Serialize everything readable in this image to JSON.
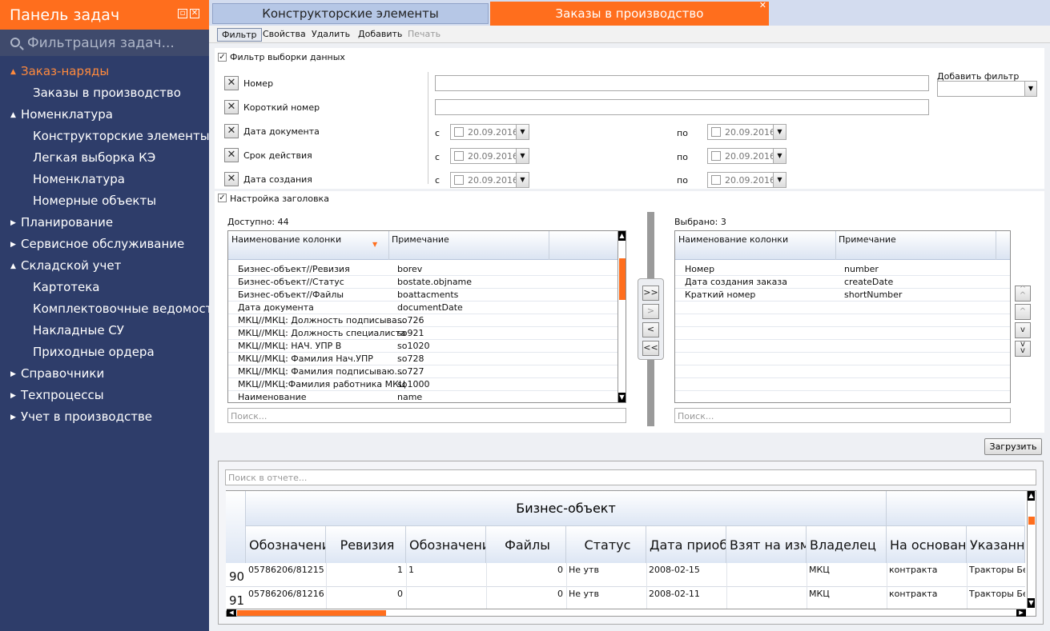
{
  "sidebar": {
    "title": "Панель задач",
    "filter_placeholder": "Фильтрация задач...",
    "items": [
      {
        "label": "Заказ-наряды",
        "level": 1,
        "expanded": true,
        "active": true
      },
      {
        "label": "Заказы в производство",
        "level": 2
      },
      {
        "label": "Номенклатура",
        "level": 1,
        "expanded": true
      },
      {
        "label": "Конструкторские элементы",
        "level": 2
      },
      {
        "label": "Легкая  выборка КЭ",
        "level": 2
      },
      {
        "label": "Номенклатура",
        "level": 2
      },
      {
        "label": "Номерные объекты",
        "level": 2
      },
      {
        "label": "Планирование",
        "level": 1,
        "expanded": false
      },
      {
        "label": "Сервисное обслуживание",
        "level": 1,
        "expanded": false
      },
      {
        "label": "Складской учет",
        "level": 1,
        "expanded": true
      },
      {
        "label": "Картотека",
        "level": 2
      },
      {
        "label": "Комплектовочные ведомости",
        "level": 2
      },
      {
        "label": "Накладные СУ",
        "level": 2
      },
      {
        "label": "Приходные ордера",
        "level": 2
      },
      {
        "label": "Справочники",
        "level": 1,
        "expanded": false
      },
      {
        "label": "Техпроцессы",
        "level": 1,
        "expanded": false
      },
      {
        "label": "Учет в производстве",
        "level": 1,
        "expanded": false
      }
    ]
  },
  "tabs": [
    {
      "label": "Конструкторские элементы",
      "active": false
    },
    {
      "label": "Заказы в производство",
      "active": true
    }
  ],
  "toolbar": {
    "filter": "Фильтр",
    "properties": "Свойства",
    "delete": "Удалить",
    "add": "Добавить",
    "print": "Печать"
  },
  "filter_section": {
    "title": "Фильтр выборки данных",
    "add_filter_label": "Добавить фильтр",
    "from": "с",
    "to": "по",
    "date_value": "20.09.2016",
    "fields": [
      "Номер",
      "Короткий номер",
      "Дата документа",
      "Срок действия",
      "Дата создания"
    ]
  },
  "header_section": {
    "title": "Настройка заголовка",
    "available_label": "Доступно: 44",
    "selected_label": "Выбрано: 3",
    "col_name": "Наименование колонки",
    "col_note": "Примечание",
    "search_placeholder": "Поиск...",
    "available": [
      [
        "Бизнес-объект//Ревизия",
        "borev"
      ],
      [
        "Бизнес-объект//Статус",
        "bostate.objname"
      ],
      [
        "Бизнес-объект//Файлы",
        "boattacments"
      ],
      [
        "Дата документа",
        "documentDate"
      ],
      [
        "МКЦ//МКЦ: Должность подписыва...",
        "so726"
      ],
      [
        "МКЦ//МКЦ: Должность специалиста",
        "so921"
      ],
      [
        "МКЦ//МКЦ: НАЧ. УПР В",
        "so1020"
      ],
      [
        "МКЦ//МКЦ: Фамилия Нач.УПР",
        "so728"
      ],
      [
        "МКЦ//МКЦ: Фамилия подписываю...",
        "so727"
      ],
      [
        "МКЦ//МКЦ:Фамилия работника МКЦ",
        "so1000"
      ],
      [
        "Наименование",
        "name"
      ]
    ],
    "selected": [
      [
        "Номер",
        "number"
      ],
      [
        "Дата создания заказа",
        "createDate"
      ],
      [
        "Краткий номер",
        "shortNumber"
      ]
    ],
    "move_buttons": [
      ">>",
      ">",
      "<",
      "<<"
    ]
  },
  "load_button": "Загрузить",
  "report": {
    "search_placeholder": "Поиск в отчете...",
    "group_header": "Бизнес-объект",
    "sort_index": "1",
    "columns": [
      "Обозначени",
      "Ревизия",
      "Обозначени",
      "Файлы",
      "Статус",
      "Дата приобр",
      "Взят на изм",
      "Владелец",
      "На основани",
      "Указанны"
    ],
    "rows": [
      {
        "num": "90",
        "cells": [
          "05786206/81215",
          "1",
          "1",
          "0",
          "Не утв",
          "2008-02-15",
          "",
          "МКЦ",
          "контракта",
          "Тракторы Бе"
        ]
      },
      {
        "num": "91",
        "cells": [
          "05786206/81216",
          "0",
          "",
          "0",
          "Не утв",
          "2008-02-11",
          "",
          "МКЦ",
          "контракта",
          "Тракторы Бе"
        ]
      }
    ]
  },
  "colors": {
    "accent": "#ff6e1d",
    "sidebar_bg": "#2e3d6a"
  }
}
